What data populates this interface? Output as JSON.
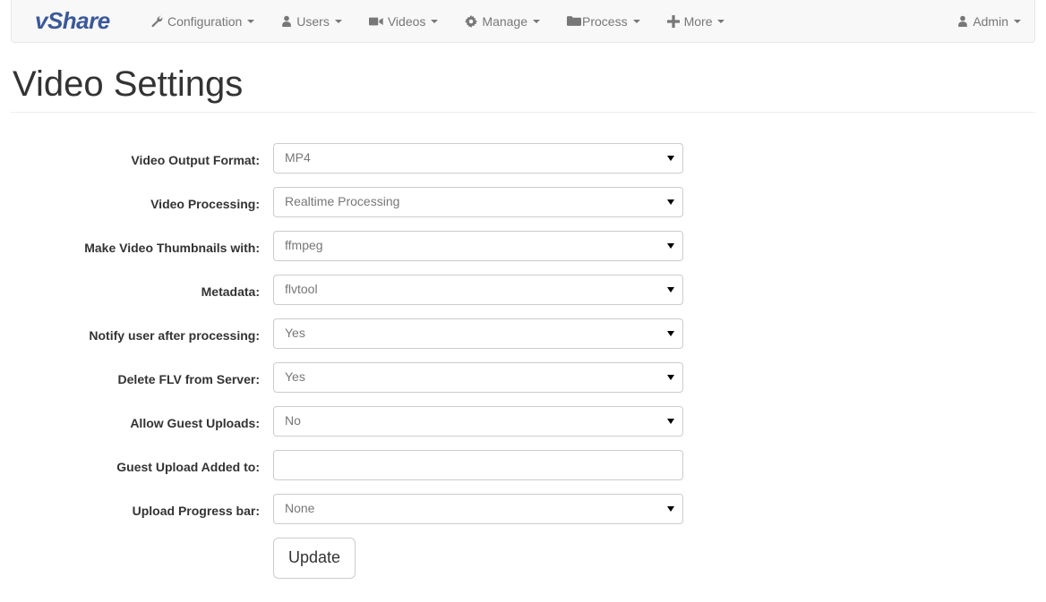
{
  "brand": {
    "label": "vShare",
    "color": "#3b5998"
  },
  "navbar": {
    "items": [
      {
        "label": "Configuration",
        "icon": "wrench-icon",
        "caret": true
      },
      {
        "label": "Users",
        "icon": "user-icon",
        "caret": true
      },
      {
        "label": "Videos",
        "icon": "video-camera-icon",
        "caret": true
      },
      {
        "label": "Manage",
        "icon": "gear-icon",
        "caret": true
      },
      {
        "label": "Process",
        "icon": "folder-icon",
        "caret": true
      },
      {
        "label": "More",
        "icon": "plus-icon",
        "caret": true
      }
    ],
    "account": {
      "label": "Admin",
      "icon": "user-icon",
      "caret": true
    }
  },
  "page": {
    "title": "Video Settings"
  },
  "form": {
    "rows": [
      {
        "label": "Video Output Format:",
        "type": "select",
        "value": "MP4",
        "name": "video-output-format"
      },
      {
        "label": "Video Processing:",
        "type": "select",
        "value": "Realtime Processing",
        "name": "video-processing"
      },
      {
        "label": "Make Video Thumbnails with:",
        "type": "select",
        "value": "ffmpeg",
        "name": "make-video-thumbnails-with"
      },
      {
        "label": "Metadata:",
        "type": "select",
        "value": "flvtool",
        "name": "metadata"
      },
      {
        "label": "Notify user after processing:",
        "type": "select",
        "value": "Yes",
        "name": "notify-user-after-processing"
      },
      {
        "label": "Delete FLV from Server:",
        "type": "select",
        "value": "Yes",
        "name": "delete-flv-from-server"
      },
      {
        "label": "Allow Guest Uploads:",
        "type": "select",
        "value": "No",
        "name": "allow-guest-uploads"
      },
      {
        "label": "Guest Upload Added to:",
        "type": "text",
        "value": "",
        "placeholder": "",
        "name": "guest-upload-added-to"
      },
      {
        "label": "Upload Progress bar:",
        "type": "select",
        "value": "None",
        "name": "upload-progress-bar"
      }
    ],
    "submit_label": "Update"
  }
}
